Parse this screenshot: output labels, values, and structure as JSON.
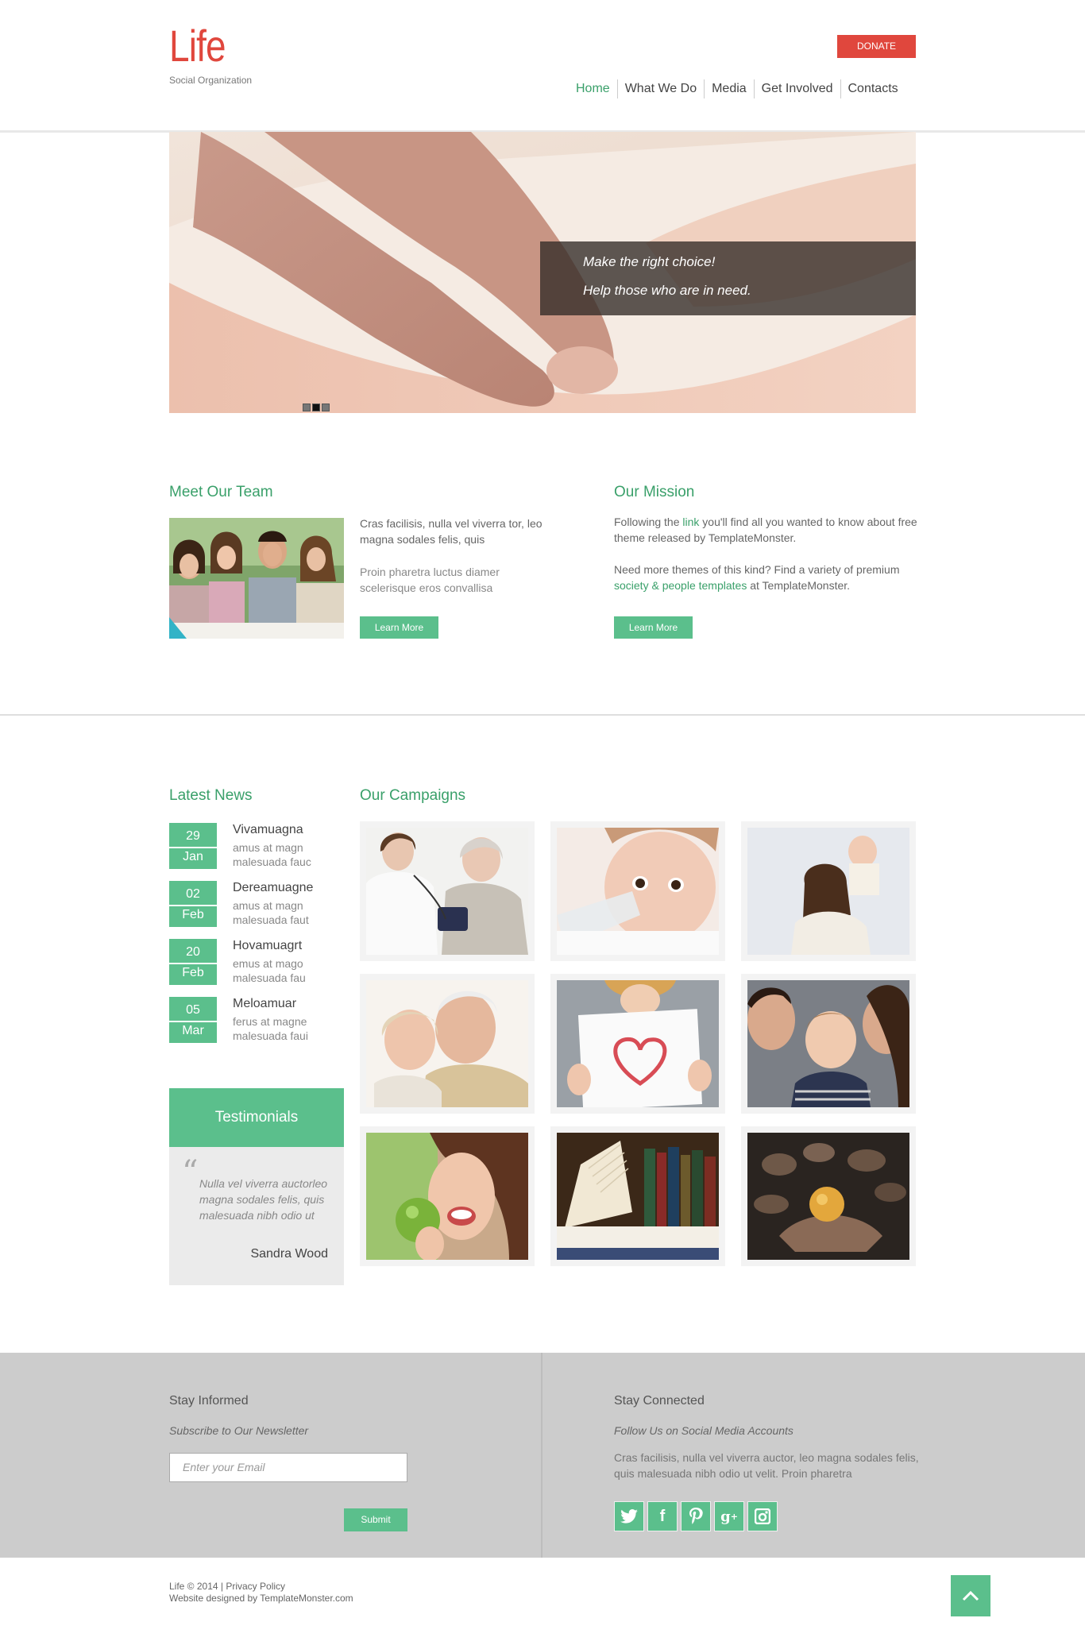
{
  "header": {
    "logo": "Life",
    "tagline": "Social Organization",
    "donate_label": "DONATE",
    "nav": [
      "Home",
      "What We Do",
      "Media",
      "Get Involved",
      "Contacts"
    ]
  },
  "hero": {
    "caption_line1": "Make the right choice!",
    "caption_line2": "Help those who are in need.",
    "slides": 3,
    "active_slide": 2
  },
  "team": {
    "title": "Meet Our Team",
    "text1": "Cras facilisis, nulla vel viverra tor, leo magna sodales felis, quis",
    "text2": "Proin pharetra luctus diamer scelerisque eros convallisa",
    "button": "Learn More"
  },
  "mission": {
    "title": "Our Mission",
    "text1_pre": "Following the ",
    "text1_link": "link",
    "text1_post": " you'll find all you wanted to know about free theme released by TemplateMonster.",
    "text2_pre": "Need more themes of this kind? Find a variety of premium ",
    "text2_link": "society & people templates",
    "text2_post": " at TemplateMonster.",
    "button": "Learn More"
  },
  "news": {
    "title": "Latest News",
    "items": [
      {
        "day": "29",
        "month": "Jan",
        "title": "Vivamuagna",
        "line1": "amus at magn",
        "line2": "malesuada fauc"
      },
      {
        "day": "02",
        "month": "Feb",
        "title": "Dereamuagne",
        "line1": "amus at magn",
        "line2": "malesuada faut"
      },
      {
        "day": "20",
        "month": "Feb",
        "title": "Hovamuagrt",
        "line1": "emus at mago",
        "line2": "malesuada fau"
      },
      {
        "day": "05",
        "month": "Mar",
        "title": "Meloamuar",
        "line1": "ferus at magne",
        "line2": "malesuada faui"
      }
    ]
  },
  "testimonials": {
    "title": "Testimonials",
    "quote": "Nulla vel viverra auctorleo magna sodales felis, quis malesuada nibh odio ut",
    "author": "Sandra Wood"
  },
  "campaigns": {
    "title": "Our Campaigns",
    "images": [
      "nurse-checking-elderly-woman",
      "baby-drinking-bottle",
      "mother-with-baby",
      "elderly-couple",
      "child-with-heart-drawing",
      "parents-kissing-baby",
      "woman-eating-apple",
      "books",
      "hands-holding-orange"
    ]
  },
  "footer": {
    "informed_title": "Stay Informed",
    "informed_sub": "Subscribe to Our Newsletter",
    "email_placeholder": "Enter your Email",
    "submit": "Submit",
    "connected_title": "Stay Connected",
    "connected_sub": "Follow Us on Social Media Accounts",
    "connected_text": "Cras facilisis, nulla vel viverra auctor, leo magna sodales felis, quis malesuada nibh odio ut velit. Proin pharetra",
    "social_icons": [
      "twitter-icon",
      "facebook-icon",
      "pinterest-icon",
      "google-plus-icon",
      "instagram-icon"
    ]
  },
  "bottom": {
    "copyright": "Life © 2014 | Privacy Policy",
    "credit": "Website designed by TemplateMonster.com"
  },
  "colors": {
    "brand_red": "#e0473d",
    "accent_green": "#5bbf8c",
    "link_green": "#3aa06a"
  }
}
